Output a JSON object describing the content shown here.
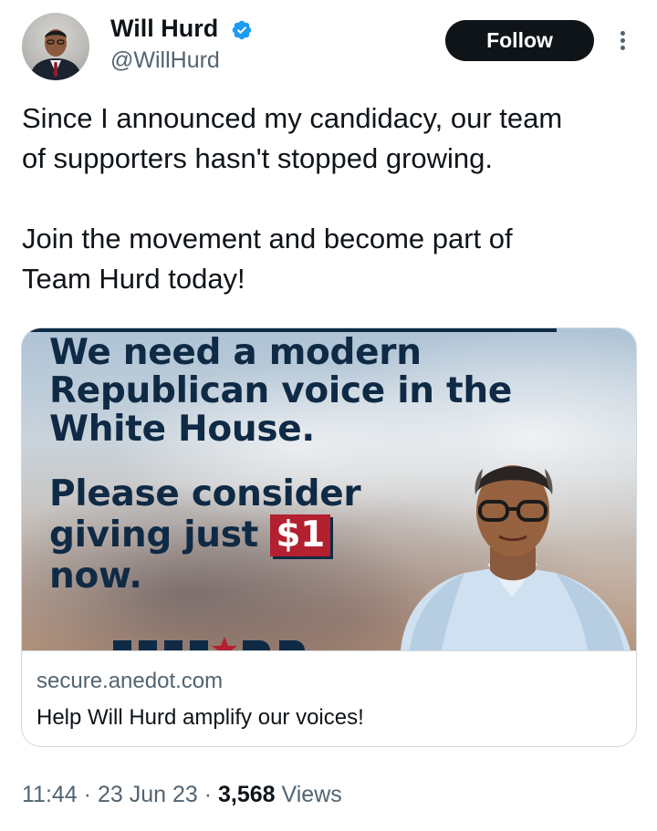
{
  "user": {
    "name": "Will Hurd",
    "handle": "@WillHurd",
    "follow_label": "Follow"
  },
  "tweet": {
    "text": "Since I announced my candidacy, our team\nof supporters hasn't stopped growing.\n\nJoin the movement and become part of\nTeam Hurd today!"
  },
  "card": {
    "headline_lines": [
      "We need a modern",
      "Republican voice in the",
      "White House."
    ],
    "ask_lines": [
      "Please consider",
      "giving just",
      "now."
    ],
    "amount": "$1",
    "domain": "secure.anedot.com",
    "title": "Help Will Hurd amplify our voices!"
  },
  "meta": {
    "time": "11:44",
    "date": "23 Jun 23",
    "views_count": "3,568",
    "views_label": "Views"
  },
  "colors": {
    "verified": "#1d9bf0",
    "follow_bg": "#0f1419",
    "headline": "#0f2a45",
    "badge": "#b3202f",
    "muted": "#536471"
  },
  "icons": [
    "verified-badge-icon",
    "more-options-icon"
  ]
}
